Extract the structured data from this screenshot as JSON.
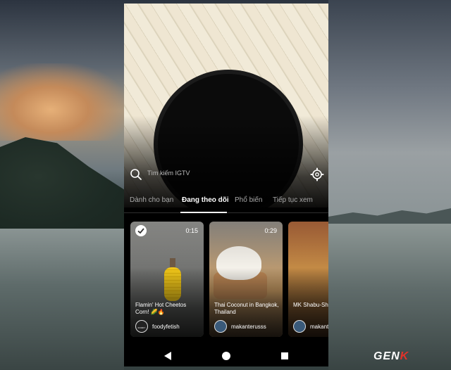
{
  "search": {
    "placeholder": "Tìm kiếm IGTV"
  },
  "tabs": [
    {
      "label": "Dành cho bạn",
      "active": false
    },
    {
      "label": "Đang theo dõi",
      "active": true
    },
    {
      "label": "Phổ biến",
      "active": false
    },
    {
      "label": "Tiếp tục xem",
      "active": false
    }
  ],
  "cards": [
    {
      "duration": "0:15",
      "title": "Flamin' Hot Cheetos Corn! 🌽🔥",
      "username": "foodyfetish",
      "avatar_text": "FOODY",
      "checked": true
    },
    {
      "duration": "0:29",
      "title": "Thai Coconut in Bangkok, Thailand",
      "username": "makanterusss"
    },
    {
      "title": "MK Shabu-Sha Kong",
      "username": "makant"
    }
  ],
  "watermark": {
    "text_main": "GEN",
    "text_accent": "K"
  },
  "colors": {
    "background": "#000000",
    "active_tab": "#ffffff",
    "inactive_tab": "#a9a9a9"
  },
  "icons": {
    "search": "search-icon",
    "settings": "gear-icon",
    "check": "check-icon",
    "back": "back-icon",
    "home": "home-icon",
    "recents": "recents-icon"
  }
}
